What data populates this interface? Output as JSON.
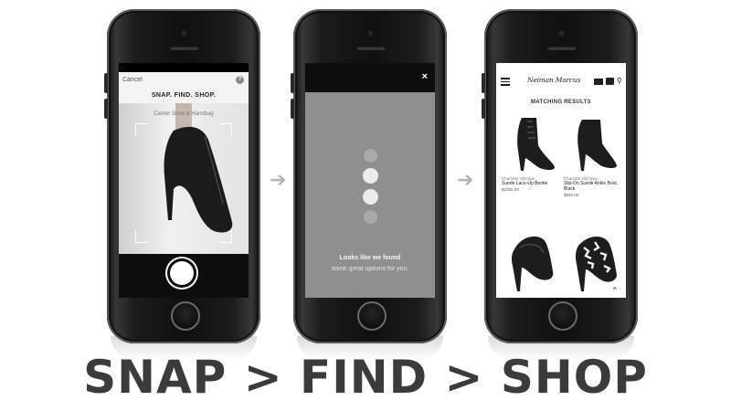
{
  "screen1": {
    "cancel_label": "Cancel",
    "title": "SNAP. FIND. SHOP.",
    "hint": "Center Shoe & Handbag"
  },
  "screen2": {
    "close_label": "×",
    "line1": "Looks like we found",
    "line2": "some great options for you."
  },
  "screen3": {
    "logo": "Neiman Marcus",
    "heading": "MATCHING RESULTS",
    "products": [
      {
        "brand": "Charlotte Olympia",
        "name": "Suede Lace-Up Bootie",
        "price": "$1015.00"
      },
      {
        "brand": "Charlotte Olympia",
        "name": "Slip-On Suede Ankle Boot, Black",
        "price": "$940.00"
      }
    ]
  },
  "arrows": [
    "➔",
    "➔"
  ],
  "caption": "SNAP > FIND > SHOP"
}
